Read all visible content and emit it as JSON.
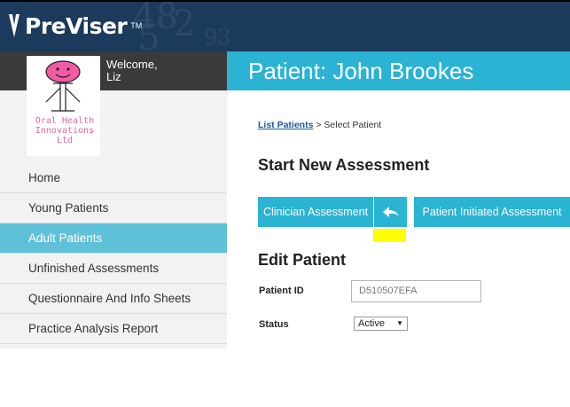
{
  "app": {
    "brand": "PreViser",
    "trademark": "TM"
  },
  "header": {
    "decor": [
      "48",
      "5",
      "2",
      "93"
    ]
  },
  "sidebar": {
    "welcome": "Welcome,",
    "user": "Liz",
    "company_lines": [
      "Oral Health",
      "Innovations",
      "Ltd"
    ],
    "items": [
      {
        "label": "Home"
      },
      {
        "label": "Young Patients"
      },
      {
        "label": "Adult Patients"
      },
      {
        "label": "Unfinished Assessments"
      },
      {
        "label": "Questionnaire And Info Sheets"
      },
      {
        "label": "Practice Analysis Report"
      }
    ]
  },
  "main": {
    "title": "Patient: John Brookes",
    "breadcrumb": {
      "link": "List Patients",
      "separator": " > ",
      "current": "Select Patient"
    },
    "new_assessment_heading": "Start New Assessment",
    "buttons": {
      "clinician": "Clinician Assessment",
      "patient_initiated": "Patient Initiated Assessment"
    },
    "edit_heading": "Edit Patient",
    "form": {
      "patient_id_label": "Patient ID",
      "patient_id_value": "D510507EFA",
      "status_label": "Status",
      "status_value": "Active"
    }
  },
  "colors": {
    "accent": "#2bb3d3",
    "header": "#1b3a5c",
    "active_nav": "#5fc1d7",
    "highlight": "#ffff00",
    "company_pink": "#e06aa6"
  }
}
